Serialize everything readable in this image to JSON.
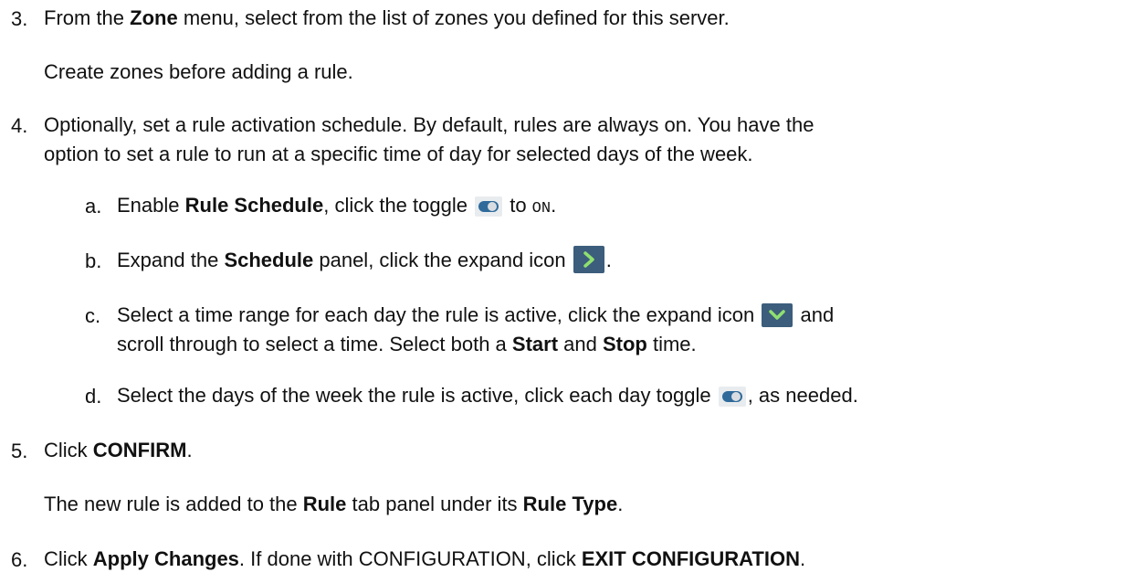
{
  "steps": [
    {
      "number": "3.",
      "pre": "From the ",
      "bold1": "Zone",
      "post": " menu, select from the list of zones you defined for this server.",
      "note": "Create zones before adding a rule."
    },
    {
      "number": "4.",
      "line1": "Optionally, set a rule activation schedule. By default, rules are always on. You have the",
      "line2": "option to set a rule to run at a specific time of day for selected days of the week.",
      "substeps": {
        "a": {
          "letter": "a.",
          "pre": "Enable ",
          "bold": "Rule Schedule",
          "mid": ", click the toggle ",
          "after_icon": " to ",
          "mono": "ON",
          "end": "."
        },
        "b": {
          "letter": "b.",
          "pre": "Expand the ",
          "bold": "Schedule",
          "mid": " panel, click the expand icon ",
          "end": "."
        },
        "c": {
          "letter": "c.",
          "line1_pre": "Select a time range for each day the rule is active, click the expand icon ",
          "line1_end": " and",
          "line2_pre": "scroll through to select a time. Select both a ",
          "bold1": "Start",
          "and": " and ",
          "bold2": "Stop",
          "line2_end": " time."
        },
        "d": {
          "letter": "d.",
          "pre": "Select the days of the week the rule is active, click each day toggle ",
          "end": ", as needed."
        }
      }
    },
    {
      "number": "5.",
      "pre": "Click ",
      "bold1": "CONFIRM",
      "post": ".",
      "note_pre": "The new rule is added to the ",
      "note_bold1": "Rule",
      "note_mid": " tab panel under its ",
      "note_bold2": "Rule Type",
      "note_end": "."
    },
    {
      "number": "6.",
      "pre": "Click ",
      "bold1": "Apply Changes",
      "mid": ". If done with CONFIGURATION, click ",
      "bold2": "EXIT CONFIGURATION",
      "end": "."
    }
  ],
  "icons": {
    "toggle": "toggle-icon",
    "expand_right": "chevron-right-icon",
    "expand_down": "chevron-down-icon"
  },
  "colors": {
    "text": "#111111",
    "icon_bg": "#3c5d7c",
    "toggle_knob": "#2f6a9a"
  }
}
